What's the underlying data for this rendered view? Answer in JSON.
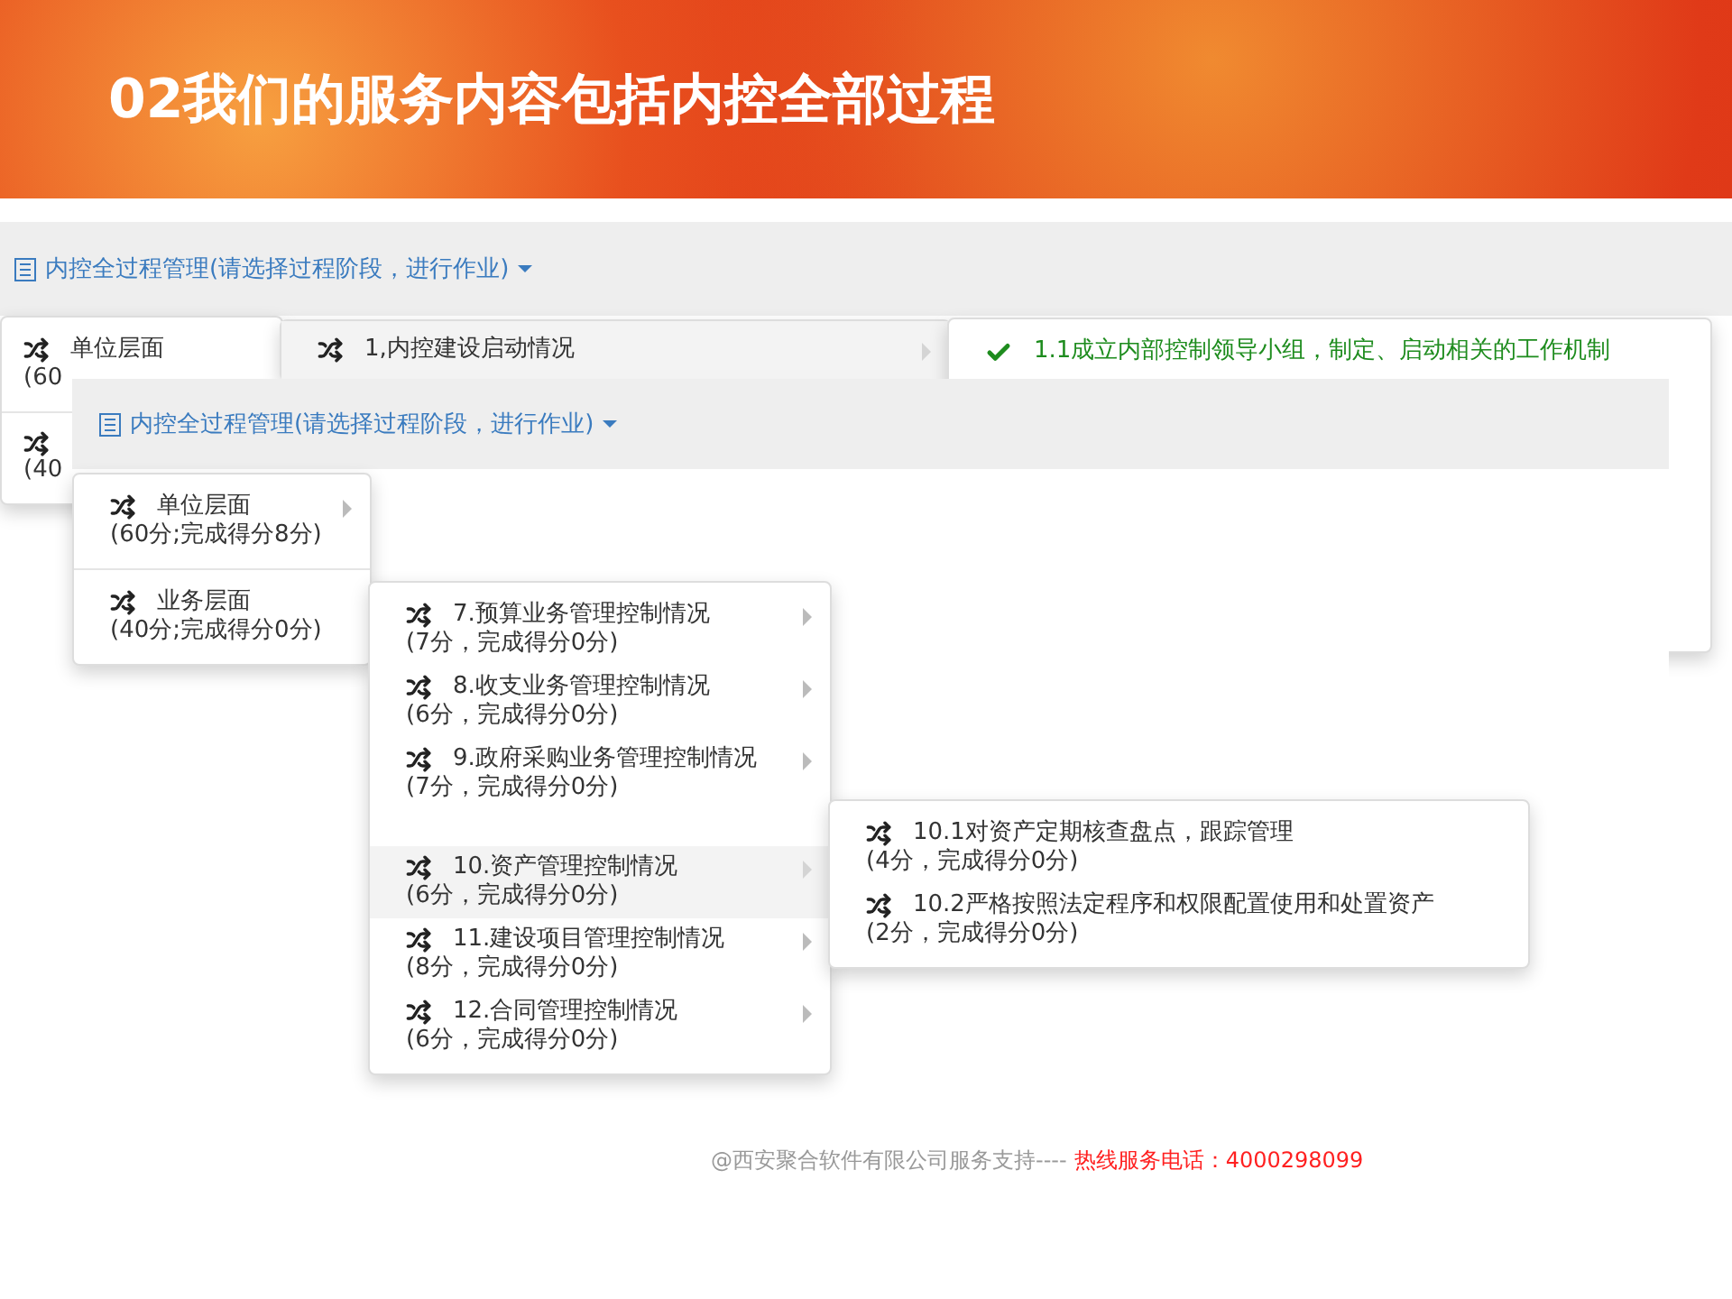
{
  "slide": {
    "title": "02我们的服务内容包括内控全部过程"
  },
  "back_screenshot": {
    "dropdown": {
      "label": "内控全过程管理(请选择过程阶段，进行作业)"
    },
    "menu": [
      {
        "label": "单位层面",
        "score": "(60"
      },
      {
        "score": "(40"
      }
    ],
    "submenu": [
      {
        "label": "1,内控建设启动情况",
        "selected": true
      }
    ],
    "subsubmenu": [
      {
        "label": "1.1成立内部控制领导小组，制定、启动相关的工作机制",
        "done": true
      }
    ]
  },
  "front_screenshot": {
    "dropdown": {
      "label": "内控全过程管理(请选择过程阶段，进行作业)"
    },
    "menu": [
      {
        "label": "单位层面",
        "score": "(60分;完成得分8分)",
        "has_children": true
      },
      {
        "label": "业务层面",
        "score": "(40分;完成得分0分)",
        "has_children": false
      }
    ],
    "submenu": [
      {
        "label": "7.预算业务管理控制情况",
        "score": "(7分，完成得分0分)",
        "selected": false
      },
      {
        "label": "8.收支业务管理控制情况",
        "score": "(6分，完成得分0分)",
        "selected": false
      },
      {
        "label": "9.政府采购业务管理控制情况",
        "score": "(7分，完成得分0分)",
        "selected": false
      },
      {
        "label": "10.资产管理控制情况",
        "score": "(6分，完成得分0分)",
        "selected": true
      },
      {
        "label": "11.建设项目管理控制情况",
        "score": "(8分，完成得分0分)",
        "selected": false
      },
      {
        "label": "12.合同管理控制情况",
        "score": "(6分，完成得分0分)",
        "selected": false
      }
    ],
    "subsubmenu": [
      {
        "label": "10.1对资产定期核查盘点，跟踪管理",
        "score": "(4分，完成得分0分)",
        "done": false
      },
      {
        "label": "10.2严格按照法定程序和权限配置使用和处置资产",
        "score": "(2分，完成得分0分)",
        "done": false
      }
    ]
  },
  "footer": {
    "credit": "@西安聚合软件有限公司服务支持----",
    "hotline": "热线服务电话：4000298099"
  }
}
